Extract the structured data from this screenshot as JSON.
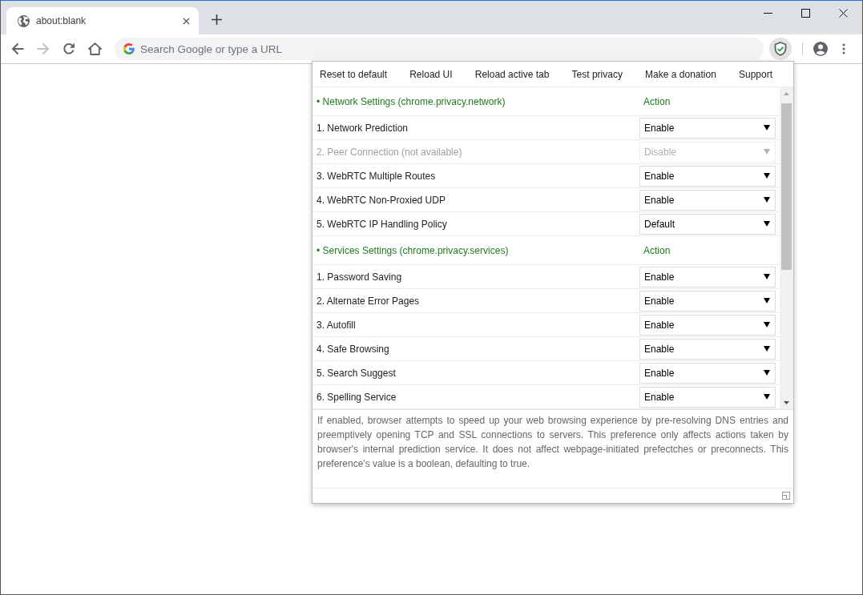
{
  "browser": {
    "tab": {
      "title": "about:blank"
    },
    "toolbar": {
      "back_disabled": false,
      "forward_disabled": true
    },
    "address_bar": {
      "placeholder": "Search Google or type a URL"
    },
    "extension_button": {
      "pressed": true
    }
  },
  "popup": {
    "menu": [
      "Reset to default",
      "Reload UI",
      "Reload active tab",
      "Test privacy",
      "Make a donation",
      "Support"
    ],
    "sections": [
      {
        "title": "• Network Settings (chrome.privacy.network)",
        "action_heading": "Action",
        "rows": [
          {
            "label": "1. Network Prediction",
            "value": "Enable",
            "disabled": false
          },
          {
            "label": "2. Peer Connection (not available)",
            "value": "Disable",
            "disabled": true
          },
          {
            "label": "3. WebRTC Multiple Routes",
            "value": "Enable",
            "disabled": false
          },
          {
            "label": "4. WebRTC Non-Proxied UDP",
            "value": "Enable",
            "disabled": false
          },
          {
            "label": "5. WebRTC IP Handling Policy",
            "value": "Default",
            "disabled": false
          }
        ]
      },
      {
        "title": "• Services Settings (chrome.privacy.services)",
        "action_heading": "Action",
        "rows": [
          {
            "label": "1. Password Saving",
            "value": "Enable",
            "disabled": false
          },
          {
            "label": "2. Alternate Error Pages",
            "value": "Enable",
            "disabled": false
          },
          {
            "label": "3. Autofill",
            "value": "Enable",
            "disabled": false
          },
          {
            "label": "4. Safe Browsing",
            "value": "Enable",
            "disabled": false
          },
          {
            "label": "5. Search Suggest",
            "value": "Enable",
            "disabled": false
          },
          {
            "label": "6. Spelling Service",
            "value": "Enable",
            "disabled": false
          }
        ]
      }
    ],
    "description": "If enabled, browser attempts to speed up your web browsing experience by pre-resolving DNS entries and preemptively opening TCP and SSL connections to servers. This preference only affects actions taken by browser's internal prediction service. It does not affect webpage-initiated prefectches or preconnects. This preference's value is a boolean, defaulting to true."
  }
}
